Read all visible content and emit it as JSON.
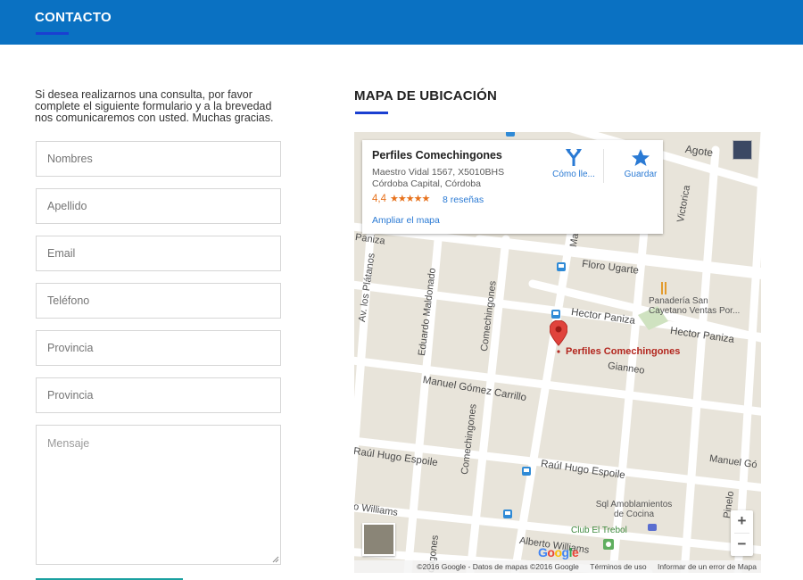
{
  "header": {
    "title": "CONTACTO",
    "bg_color": "#0a71c2",
    "accent_color": "#1a3fd1"
  },
  "intro": {
    "text": "Si desea realizarnos una consulta, por favor complete el siguiente formulario y a la brevedad nos comunicaremos con usted. Muchas gracias."
  },
  "form": {
    "fields": [
      {
        "placeholder": "Nombres",
        "value": ""
      },
      {
        "placeholder": "Apellido",
        "value": ""
      },
      {
        "placeholder": "Email",
        "value": ""
      },
      {
        "placeholder": "Teléfono",
        "value": ""
      },
      {
        "placeholder": "Provincia",
        "value": ""
      },
      {
        "placeholder": "Provincia",
        "value": ""
      }
    ],
    "message_placeholder": "Mensaje"
  },
  "map_section": {
    "title": "MAPA DE UBICACIÓN",
    "card": {
      "name": "Perfiles Comechingones",
      "address_line1": "Maestro Vidal 1567, X5010BHS",
      "address_line2": "Córdoba Capital, Córdoba",
      "rating": "4,4",
      "stars": "★★★★★",
      "reviews": "8 reseñas",
      "enlarge_link": "Ampliar el mapa",
      "directions_label": "Cómo lle...",
      "save_label": "Guardar"
    },
    "streets": {
      "agote": "Agote",
      "victorica": "Victorica",
      "paniza_left": "Paniza",
      "floro_ugarte": "Floro Ugarte",
      "av_los_platanos": "Av. los Plátanos",
      "eduardo_maldonado": "Eduardo Maldonado",
      "comechingones_top": "Comechingones",
      "hector_paniza_1": "Hector Paniza",
      "hector_paniza_2": "Hector Paniza",
      "gianneo": "Gianneo",
      "manuel_gomez_carrillo": "Manuel Gómez Carrillo",
      "comechingones_bottom": "Comechingones",
      "raul_hugo_espoile_left": "Raúl Hugo Espoile",
      "raul_hugo_espoile_right": "Raúl Hugo Espoile",
      "williams_left": "o Williams",
      "alberto_williams": "Alberto Williams",
      "manuel_g_right": "Manuel Gó",
      "pinelo": "Pinelo",
      "mae": "Mae",
      "ongones": "ongones"
    },
    "places": {
      "marker_label": "Perfiles Comechingones",
      "panaderia": "Panadería San Cayetano Ventas Por...",
      "sql": "Sql Amoblamientos de Cocina",
      "club": "Club El Trebol"
    },
    "zoom_in": "+",
    "zoom_out": "−",
    "google_logo": "Google",
    "attribution": {
      "copyright": "©2016 Google - Datos de mapas ©2016 Google",
      "terms": "Términos de uso",
      "report": "Informar de un error de Mapa"
    }
  }
}
